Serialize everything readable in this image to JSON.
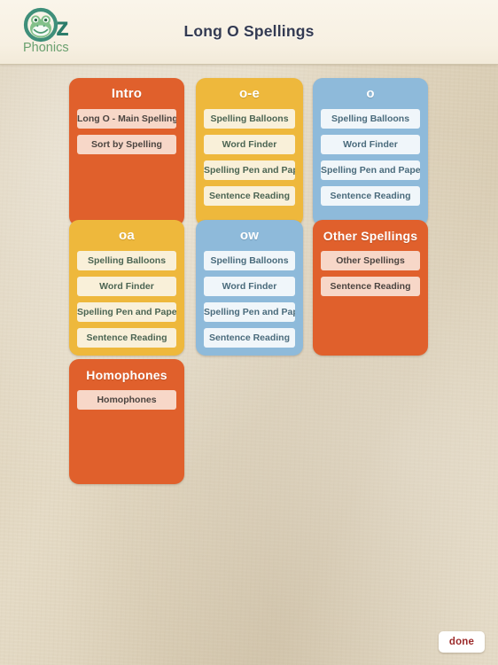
{
  "header": {
    "title": "Long O Spellings",
    "logo": {
      "brand_line1": "Oz",
      "brand_line2": "Phonics",
      "icon": "frog-face-icon",
      "color_ring": "#3f8f7a",
      "color_text": "#2b7c6a",
      "color_subtext": "#6aa06f"
    }
  },
  "board": {
    "cards": [
      {
        "id": "intro",
        "title": "Intro",
        "theme": "orange",
        "color": "#e0602c",
        "button_color": "#f7d7c8",
        "buttons": [
          "Long O - Main Spellings",
          "Sort by Spelling"
        ]
      },
      {
        "id": "oe",
        "title": "o-e",
        "theme": "gold",
        "color": "#eeb83c",
        "button_color": "#f9f0d9",
        "buttons": [
          "Spelling Balloons",
          "Word Finder",
          "Spelling Pen and Paper",
          "Sentence Reading"
        ]
      },
      {
        "id": "o",
        "title": "o",
        "theme": "blue",
        "color": "#8ebada",
        "button_color": "#f0f6fa",
        "buttons": [
          "Spelling Balloons",
          "Word Finder",
          "Spelling Pen and Paper",
          "Sentence Reading"
        ]
      },
      {
        "id": "oa",
        "title": "oa",
        "theme": "gold",
        "color": "#eeb83c",
        "button_color": "#f9f0d9",
        "buttons": [
          "Spelling Balloons",
          "Word Finder",
          "Spelling Pen and Paper",
          "Sentence Reading"
        ]
      },
      {
        "id": "ow",
        "title": "ow",
        "theme": "blue",
        "color": "#8ebada",
        "button_color": "#f0f6fa",
        "buttons": [
          "Spelling Balloons",
          "Word Finder",
          "Spelling Pen and Paper",
          "Sentence Reading"
        ]
      },
      {
        "id": "other",
        "title": "Other Spellings",
        "theme": "orange",
        "color": "#e0602c",
        "button_color": "#f7d7c8",
        "buttons": [
          "Other Spellings",
          "Sentence Reading"
        ]
      },
      {
        "id": "homophones",
        "title": "Homophones",
        "theme": "orange",
        "color": "#e0602c",
        "button_color": "#f7d7c8",
        "buttons": [
          "Homophones"
        ]
      }
    ]
  },
  "footer": {
    "done_label": "done"
  }
}
